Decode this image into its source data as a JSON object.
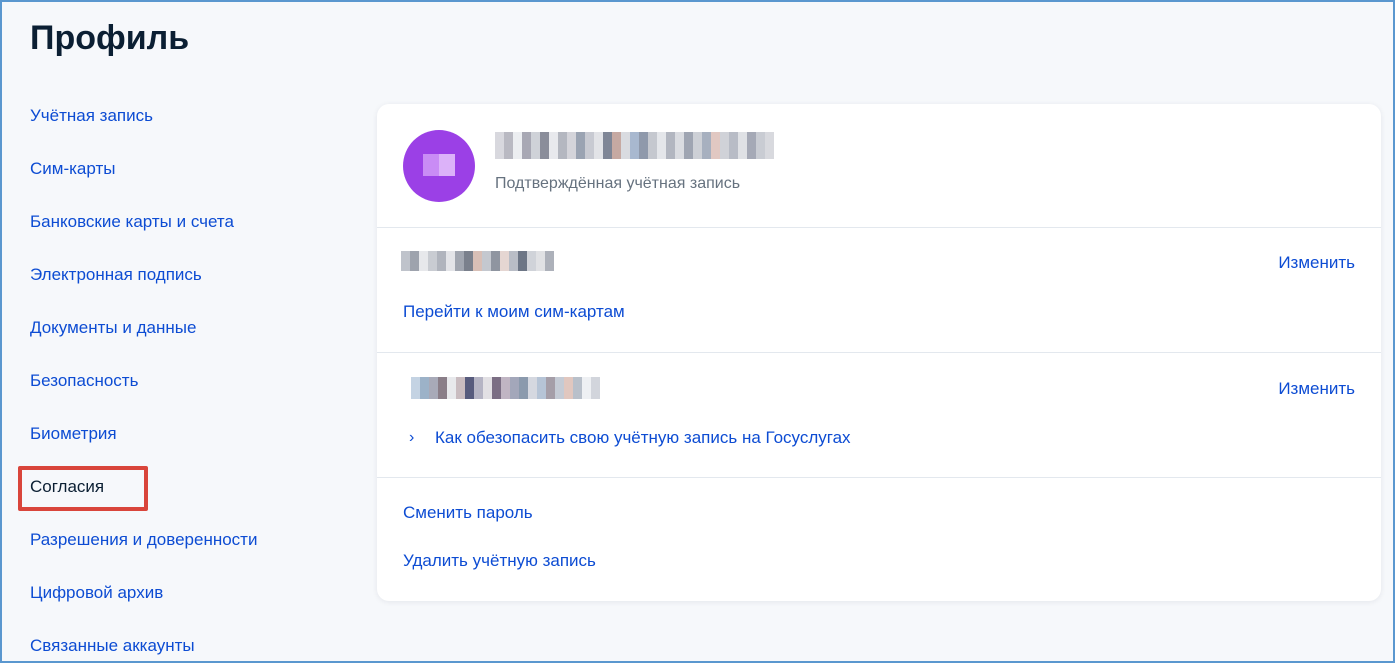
{
  "page": {
    "title": "Профиль"
  },
  "sidebar": {
    "items": [
      {
        "label": "Учётная запись",
        "active": false
      },
      {
        "label": "Сим-карты",
        "active": false
      },
      {
        "label": "Банковские карты и счета",
        "active": false
      },
      {
        "label": "Электронная подпись",
        "active": false
      },
      {
        "label": "Документы и данные",
        "active": false
      },
      {
        "label": "Безопасность",
        "active": false
      },
      {
        "label": "Биометрия",
        "active": false
      },
      {
        "label": "Согласия",
        "active": true
      },
      {
        "label": "Разрешения и доверенности",
        "active": false
      },
      {
        "label": "Цифровой архив",
        "active": false
      },
      {
        "label": "Связанные аккаунты",
        "active": false
      }
    ]
  },
  "profile": {
    "status": "Подтверждённая учётная запись"
  },
  "phone": {
    "change_label": "Изменить",
    "sim_link": "Перейти к моим сим-картам"
  },
  "email": {
    "change_label": "Изменить",
    "security_link": "Как обезопасить свою учётную запись на Госуслугах"
  },
  "actions": {
    "change_password": "Сменить пароль",
    "delete_account": "Удалить учётную запись"
  },
  "colors": {
    "link": "#0d4cd3",
    "title": "#0b1f33",
    "avatar": "#9b40e6",
    "highlight": "#d9453b",
    "frame": "#5a97cf"
  }
}
